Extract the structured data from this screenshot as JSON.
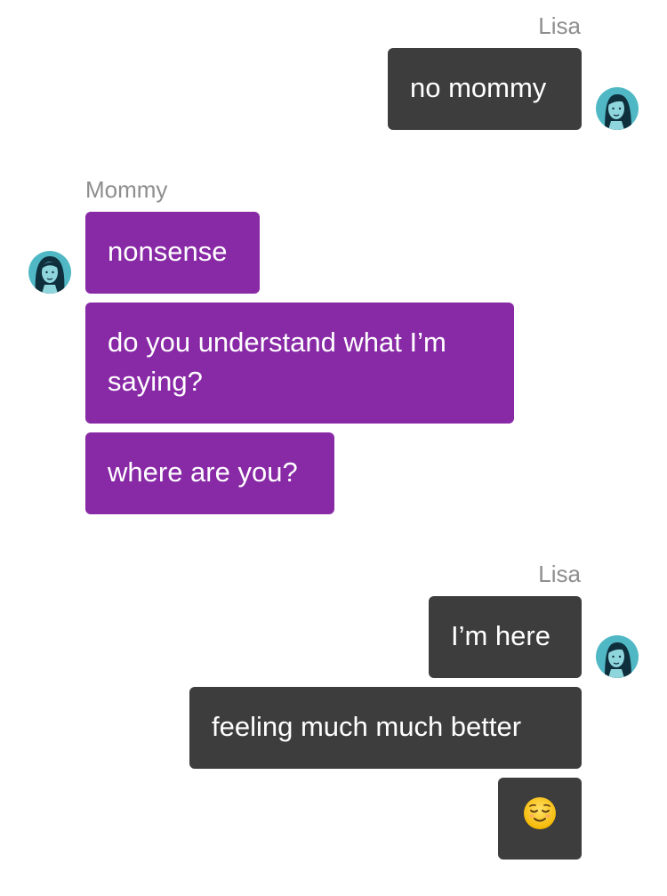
{
  "conversation": [
    {
      "sender": "Lisa",
      "direction": "outgoing",
      "messages": [
        "no mommy"
      ]
    },
    {
      "sender": "Mommy",
      "direction": "incoming",
      "messages": [
        "nonsense",
        "do you understand what I’m saying?",
        "where are you?"
      ]
    },
    {
      "sender": "Lisa",
      "direction": "outgoing",
      "messages": [
        "I’m here",
        "feeling much much better",
        "😌"
      ]
    }
  ],
  "emoji_icon": "relieved-face-emoji",
  "colors": {
    "outgoing_bubble": "#3d3d3d",
    "incoming_bubble": "#8829a6",
    "sender_name": "#8e8e8e",
    "avatar_bg": "#4fb8c4"
  }
}
